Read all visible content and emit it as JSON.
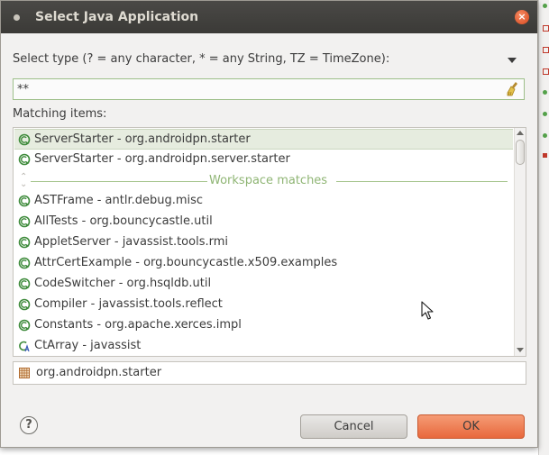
{
  "dialog": {
    "title": "Select Java Application",
    "close_symbol": "×"
  },
  "filter": {
    "label": "Select type (? = any character, * = any String, TZ = TimeZone):",
    "value": "**",
    "clear_icon": "broom-clear-icon"
  },
  "list": {
    "label": "Matching items:",
    "history_items": [
      {
        "text": "ServerStarter - org.androidpn.starter",
        "icon": "runnable-class-icon",
        "selected": true
      },
      {
        "text": "ServerStarter - org.androidpn.server.starter",
        "icon": "runnable-class-icon",
        "selected": false
      }
    ],
    "separator_label": "Workspace matches",
    "workspace_items": [
      {
        "text": "ASTFrame - antlr.debug.misc",
        "icon": "runnable-class-icon"
      },
      {
        "text": "AllTests - org.bouncycastle.util",
        "icon": "runnable-class-icon"
      },
      {
        "text": "AppletServer - javassist.tools.rmi",
        "icon": "runnable-class-icon"
      },
      {
        "text": "AttrCertExample - org.bouncycastle.x509.examples",
        "icon": "runnable-class-icon"
      },
      {
        "text": "CodeSwitcher - org.hsqldb.util",
        "icon": "runnable-class-icon"
      },
      {
        "text": "Compiler - javassist.tools.reflect",
        "icon": "runnable-class-icon"
      },
      {
        "text": "Constants - org.apache.xerces.impl",
        "icon": "runnable-class-icon"
      },
      {
        "text": "CtArray - javassist",
        "icon": "abstract-class-icon"
      }
    ]
  },
  "package_field": {
    "value": "org.androidpn.starter",
    "icon": "package-icon"
  },
  "buttons": {
    "help_symbol": "?",
    "cancel_label": "Cancel",
    "ok_label": "OK"
  },
  "colors": {
    "titlebar": "#3b3a37",
    "ok_button": "#e8683c",
    "selection": "#e6ecdf",
    "separator": "#8fb574"
  }
}
